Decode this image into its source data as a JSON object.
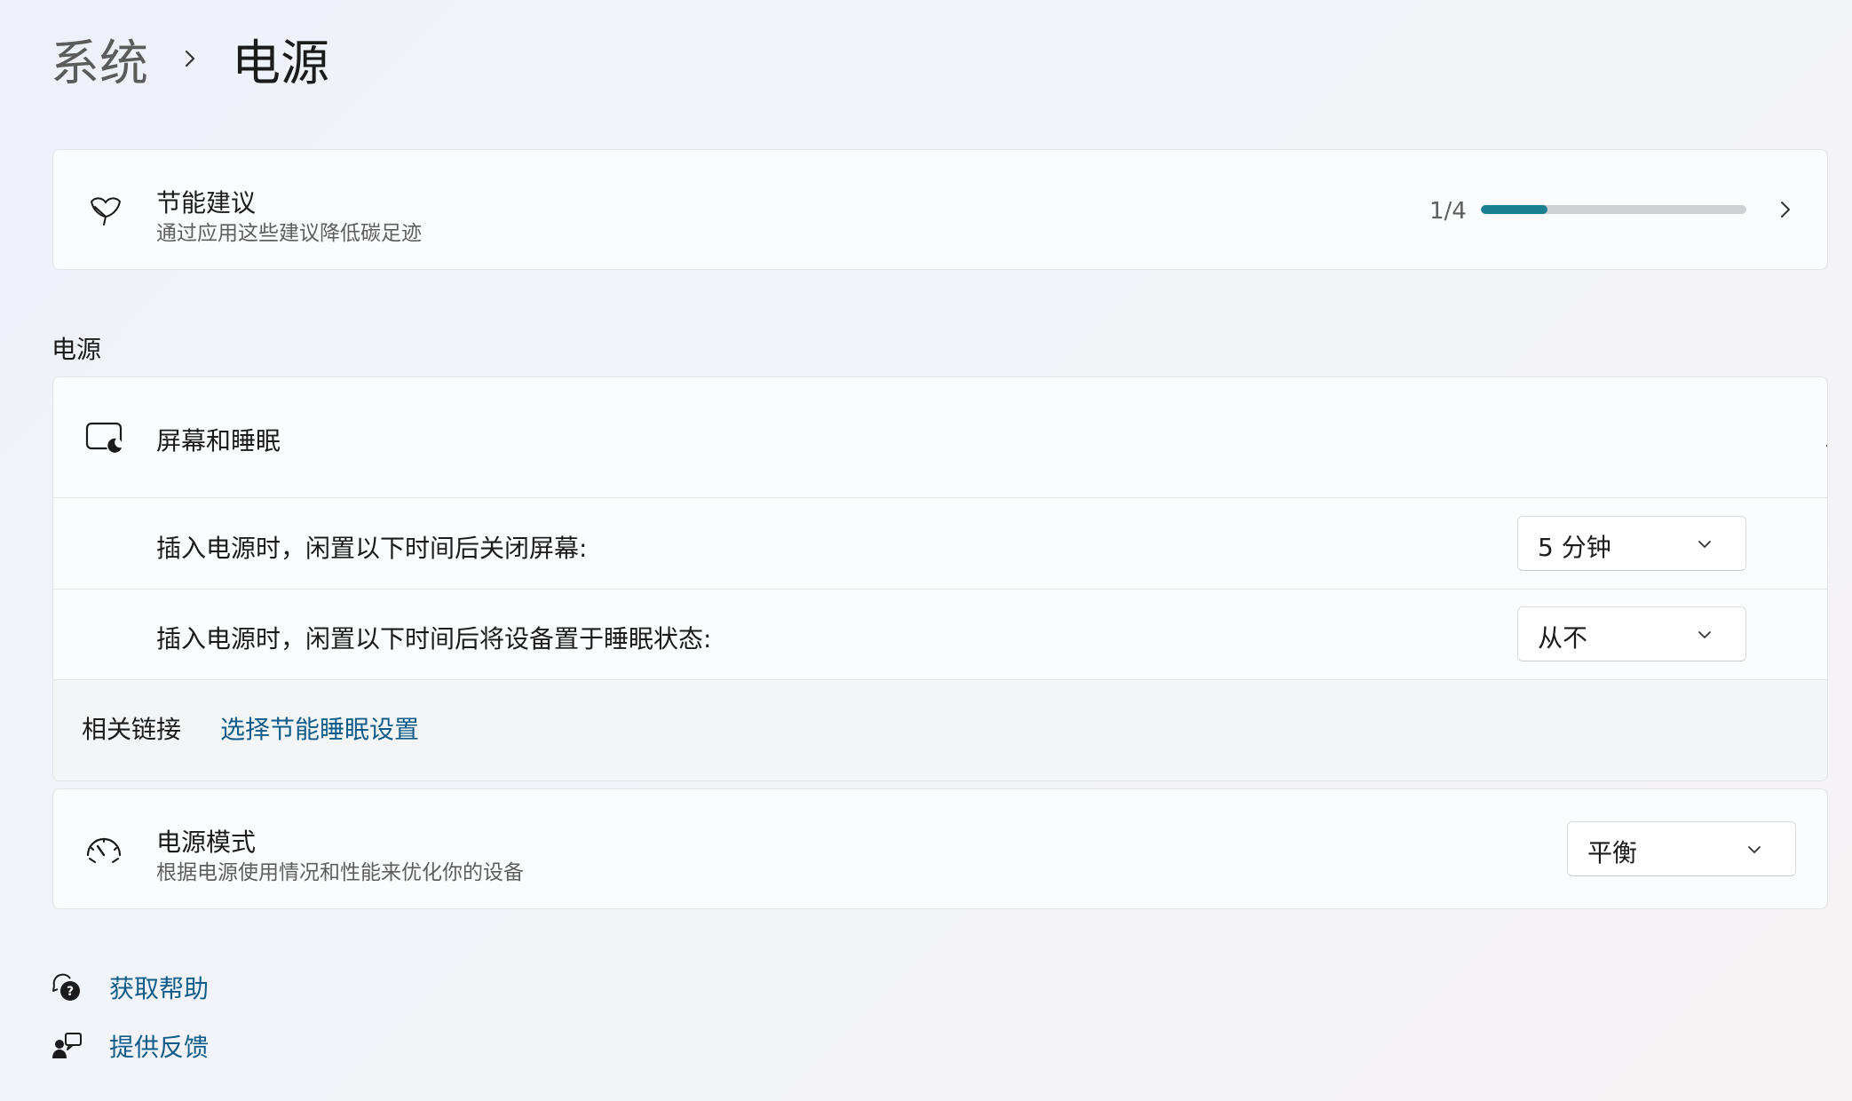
{
  "breadcrumb": {
    "parent": "系统",
    "current": "电源"
  },
  "energy_recommendations": {
    "title": "节能建议",
    "subtitle": "通过应用这些建议降低碳足迹",
    "progress_text": "1/4",
    "progress_fraction": 0.25,
    "icon": "leaf-icon"
  },
  "section_label": "电源",
  "screen_sleep": {
    "title": "屏幕和睡眠",
    "icon": "screen-sleep-icon",
    "rows": [
      {
        "label": "插入电源时，闲置以下时间后关闭屏幕:",
        "value": "5 分钟"
      },
      {
        "label": "插入电源时，闲置以下时间后将设备置于睡眠状态:",
        "value": "从不"
      }
    ]
  },
  "related": {
    "label": "相关链接",
    "link": "选择节能睡眠设置"
  },
  "power_mode": {
    "title": "电源模式",
    "subtitle": "根据电源使用情况和性能来优化你的设备",
    "value": "平衡",
    "icon": "gauge-icon"
  },
  "footer": {
    "help": "获取帮助",
    "feedback": "提供反馈"
  },
  "colors": {
    "accent": "#1a7f93",
    "link": "#0f5c8a"
  }
}
